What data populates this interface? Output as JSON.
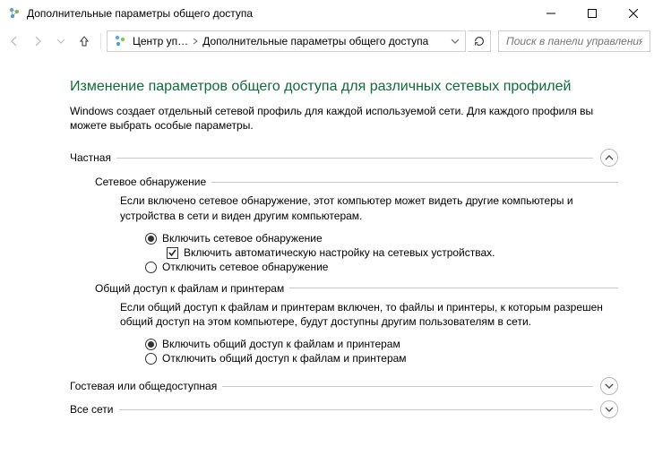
{
  "window": {
    "title": "Дополнительные параметры общего доступа"
  },
  "breadcrumb": {
    "seg1": "Центр уп…",
    "seg2": "Дополнительные параметры общего доступа"
  },
  "search": {
    "placeholder": "Поиск в панели управления"
  },
  "page": {
    "heading": "Изменение параметров общего доступа для различных сетевых профилей",
    "desc": "Windows создает отдельный сетевой профиль для каждой используемой сети. Для каждого профиля вы можете выбрать особые параметры."
  },
  "sections": {
    "private": {
      "label": "Частная",
      "network_discovery": {
        "label": "Сетевое обнаружение",
        "desc": "Если включено сетевое обнаружение, этот компьютер может видеть другие компьютеры и устройства в сети и виден другим компьютерам.",
        "opt_on": "Включить сетевое обнаружение",
        "opt_auto": "Включить автоматическую настройку на сетевых устройствах.",
        "opt_off": "Отключить сетевое обнаружение"
      },
      "file_sharing": {
        "label": "Общий доступ к файлам и принтерам",
        "desc": "Если общий доступ к файлам и принтерам включен, то файлы и принтеры, к которым разрешен общий доступ на этом компьютере, будут доступны другим пользователям в сети.",
        "opt_on": "Включить общий доступ к файлам и принтерам",
        "opt_off": "Отключить общий доступ к файлам и принтерам"
      }
    },
    "guest": {
      "label": "Гостевая или общедоступная"
    },
    "all": {
      "label": "Все сети"
    }
  }
}
